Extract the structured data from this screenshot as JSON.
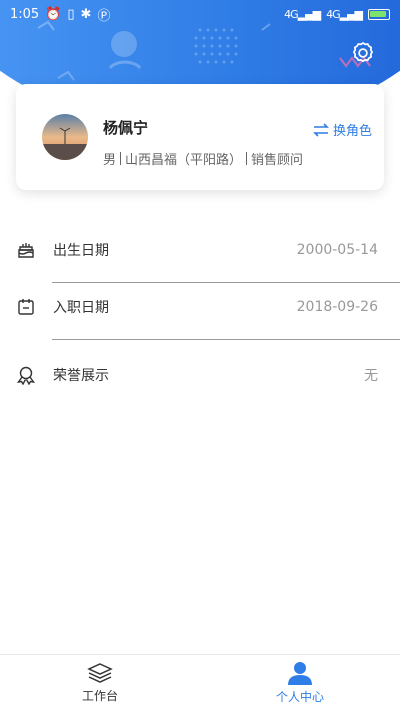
{
  "status_bar": {
    "time": "1:05",
    "network": "4G",
    "network2": "4G"
  },
  "profile": {
    "name": "杨佩宁",
    "gender": "男",
    "store": "山西昌福（平阳路）",
    "position": "销售顾问",
    "switch_role_label": "换角色"
  },
  "info": {
    "birth": {
      "label": "出生日期",
      "value": "2000-05-14"
    },
    "hire": {
      "label": "入职日期",
      "value": "2018-09-26"
    },
    "honor": {
      "label": "荣誉展示",
      "value": "无"
    }
  },
  "nav": {
    "items": [
      {
        "label": "工作台",
        "icon": "layers-icon",
        "active": false
      },
      {
        "label": "个人中心",
        "icon": "person-icon",
        "active": true
      }
    ]
  },
  "colors": {
    "accent": "#2f7de6",
    "header_start": "#4f9cf7",
    "header_end": "#1f5fd6"
  }
}
